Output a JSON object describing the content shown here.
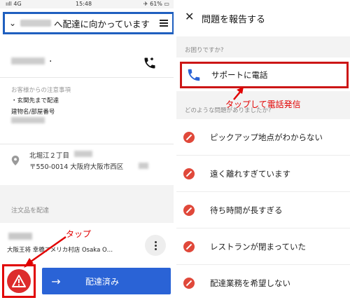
{
  "left": {
    "status": {
      "signal": "ııll 4G",
      "time": "15:48",
      "right": "✈ 61% ▭"
    },
    "header": {
      "text": "へ配達に向かっています"
    },
    "customer_note_label": "お客様からの注意事項",
    "customer_note_value": "・玄関先まで配達",
    "building_label": "建物名/部屋番号",
    "address_line1": "北堀江２丁目",
    "address_line2": "〒550-0014 大阪府大阪市西区",
    "order_section": "注文品を配達",
    "shop_name": "大阪王将 幸橋アメリカ村店 Osaka O…",
    "deliver_button": "配達済み",
    "tap_annotation": "タップ"
  },
  "right": {
    "title": "問題を報告する",
    "section_help": "お困りですか?",
    "support_label": "サポートに電話",
    "section_issue": "どのような問題がありましたか?",
    "tap_call_annotation": "タップして電話発信",
    "issues": [
      "ピックアップ地点がわからない",
      "遠く離れすぎています",
      "待ち時間が長すぎる",
      "レストランが閉まっていた",
      "配達業務を希望しない"
    ]
  },
  "colors": {
    "blue_button": "#2a63d6",
    "red_annotation": "#e10000",
    "blue_frame": "#1f5fbf",
    "no_icon": "#e0483a"
  }
}
